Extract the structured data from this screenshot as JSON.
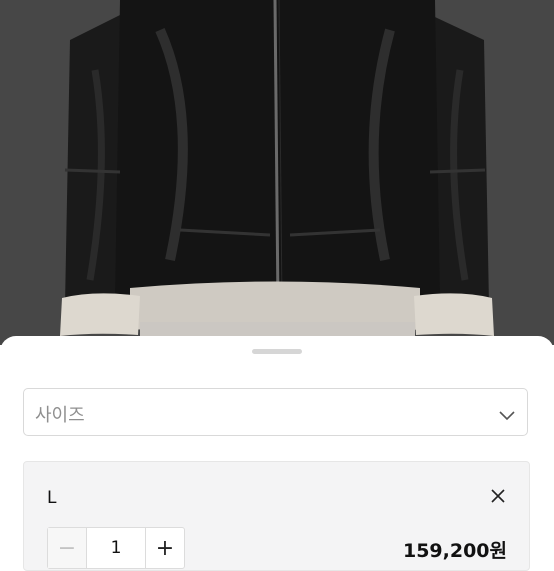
{
  "product_photo": {
    "alt": "jacket-photo"
  },
  "size_select": {
    "placeholder": "사이즈"
  },
  "selected_option": {
    "size": "L",
    "quantity": "1",
    "price": "159,200원",
    "minus_label": "−",
    "plus_label": "+"
  }
}
